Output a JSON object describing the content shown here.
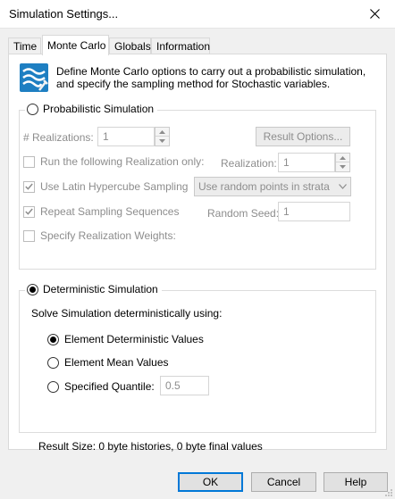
{
  "window": {
    "title": "Simulation Settings..."
  },
  "tabs": [
    {
      "label": "Time"
    },
    {
      "label": "Monte Carlo"
    },
    {
      "label": "Globals"
    },
    {
      "label": "Information"
    }
  ],
  "description": "Define Monte Carlo options to carry out a probabilistic simulation, and specify the sampling method for Stochastic variables.",
  "probabilistic": {
    "label": "Probabilistic Simulation",
    "selected": false,
    "realizations_label": "# Realizations:",
    "realizations_value": "1",
    "result_options_label": "Result Options...",
    "run_only_label": "Run the following Realization only:",
    "run_only_checked": false,
    "realization_label": "Realization:",
    "realization_value": "1",
    "lhs_label": "Use Latin Hypercube Sampling",
    "lhs_checked": true,
    "lhs_method": "Use random points in strata",
    "repeat_label": "Repeat Sampling Sequences",
    "repeat_checked": true,
    "seed_label": "Random Seed:",
    "seed_value": "1",
    "weights_label": "Specify Realization Weights:",
    "weights_checked": false
  },
  "deterministic": {
    "label": "Deterministic Simulation",
    "selected": true,
    "solve_label": "Solve Simulation deterministically using:",
    "options": [
      {
        "label": "Element Deterministic Values",
        "selected": true
      },
      {
        "label": "Element Mean Values",
        "selected": false
      },
      {
        "label": "Specified Quantile:",
        "selected": false
      }
    ],
    "quantile_value": "0.5"
  },
  "result_size": "Result Size: 0 byte histories, 0 byte final values",
  "buttons": {
    "ok": "OK",
    "cancel": "Cancel",
    "help": "Help"
  }
}
